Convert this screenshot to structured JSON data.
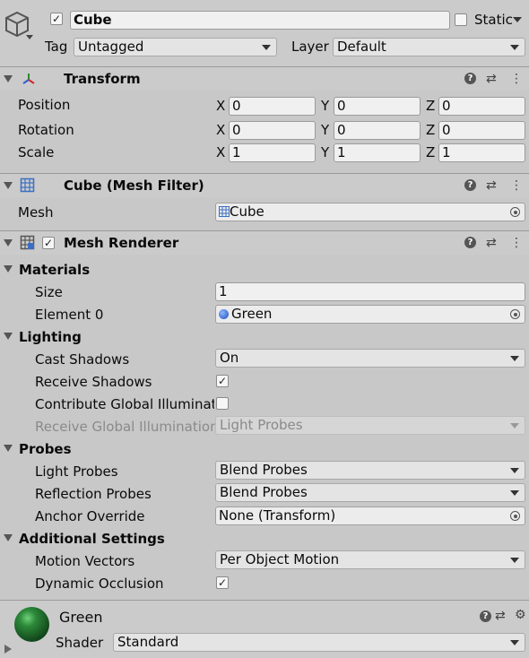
{
  "header": {
    "name": "Cube",
    "active_checked": true,
    "static_label": "Static",
    "tag_label": "Tag",
    "tag_value": "Untagged",
    "layer_label": "Layer",
    "layer_value": "Default"
  },
  "transform": {
    "title": "Transform",
    "rows": [
      {
        "label": "Position",
        "x": "0",
        "y": "0",
        "z": "0"
      },
      {
        "label": "Rotation",
        "x": "0",
        "y": "0",
        "z": "0"
      },
      {
        "label": "Scale",
        "x": "1",
        "y": "1",
        "z": "1"
      }
    ],
    "axis_x": "X",
    "axis_y": "Y",
    "axis_z": "Z"
  },
  "mesh_filter": {
    "title": "Cube (Mesh Filter)",
    "mesh_label": "Mesh",
    "mesh_value": "Cube"
  },
  "mesh_renderer": {
    "title": "Mesh Renderer",
    "enabled": true,
    "materials": {
      "label": "Materials",
      "size_label": "Size",
      "size_value": "1",
      "element0_label": "Element 0",
      "element0_value": "Green"
    },
    "lighting": {
      "label": "Lighting",
      "cast_shadows_label": "Cast Shadows",
      "cast_shadows_value": "On",
      "receive_shadows_label": "Receive Shadows",
      "receive_shadows_checked": true,
      "contribute_gi_label": "Contribute Global Illuminatic",
      "contribute_gi_checked": false,
      "receive_gi_label": "Receive Global Illumination",
      "receive_gi_value": "Light Probes"
    },
    "probes": {
      "label": "Probes",
      "light_probes_label": "Light Probes",
      "light_probes_value": "Blend Probes",
      "reflection_probes_label": "Reflection Probes",
      "reflection_probes_value": "Blend Probes",
      "anchor_override_label": "Anchor Override",
      "anchor_override_value": "None (Transform)"
    },
    "additional": {
      "label": "Additional Settings",
      "motion_vectors_label": "Motion Vectors",
      "motion_vectors_value": "Per Object Motion",
      "dynamic_occlusion_label": "Dynamic Occlusion",
      "dynamic_occlusion_checked": true
    }
  },
  "material": {
    "name": "Green",
    "shader_label": "Shader",
    "shader_value": "Standard",
    "color": "#1e6b2a"
  },
  "icons": {
    "check": "✓",
    "help": "?",
    "more": "⋮",
    "settings": "⇄"
  }
}
